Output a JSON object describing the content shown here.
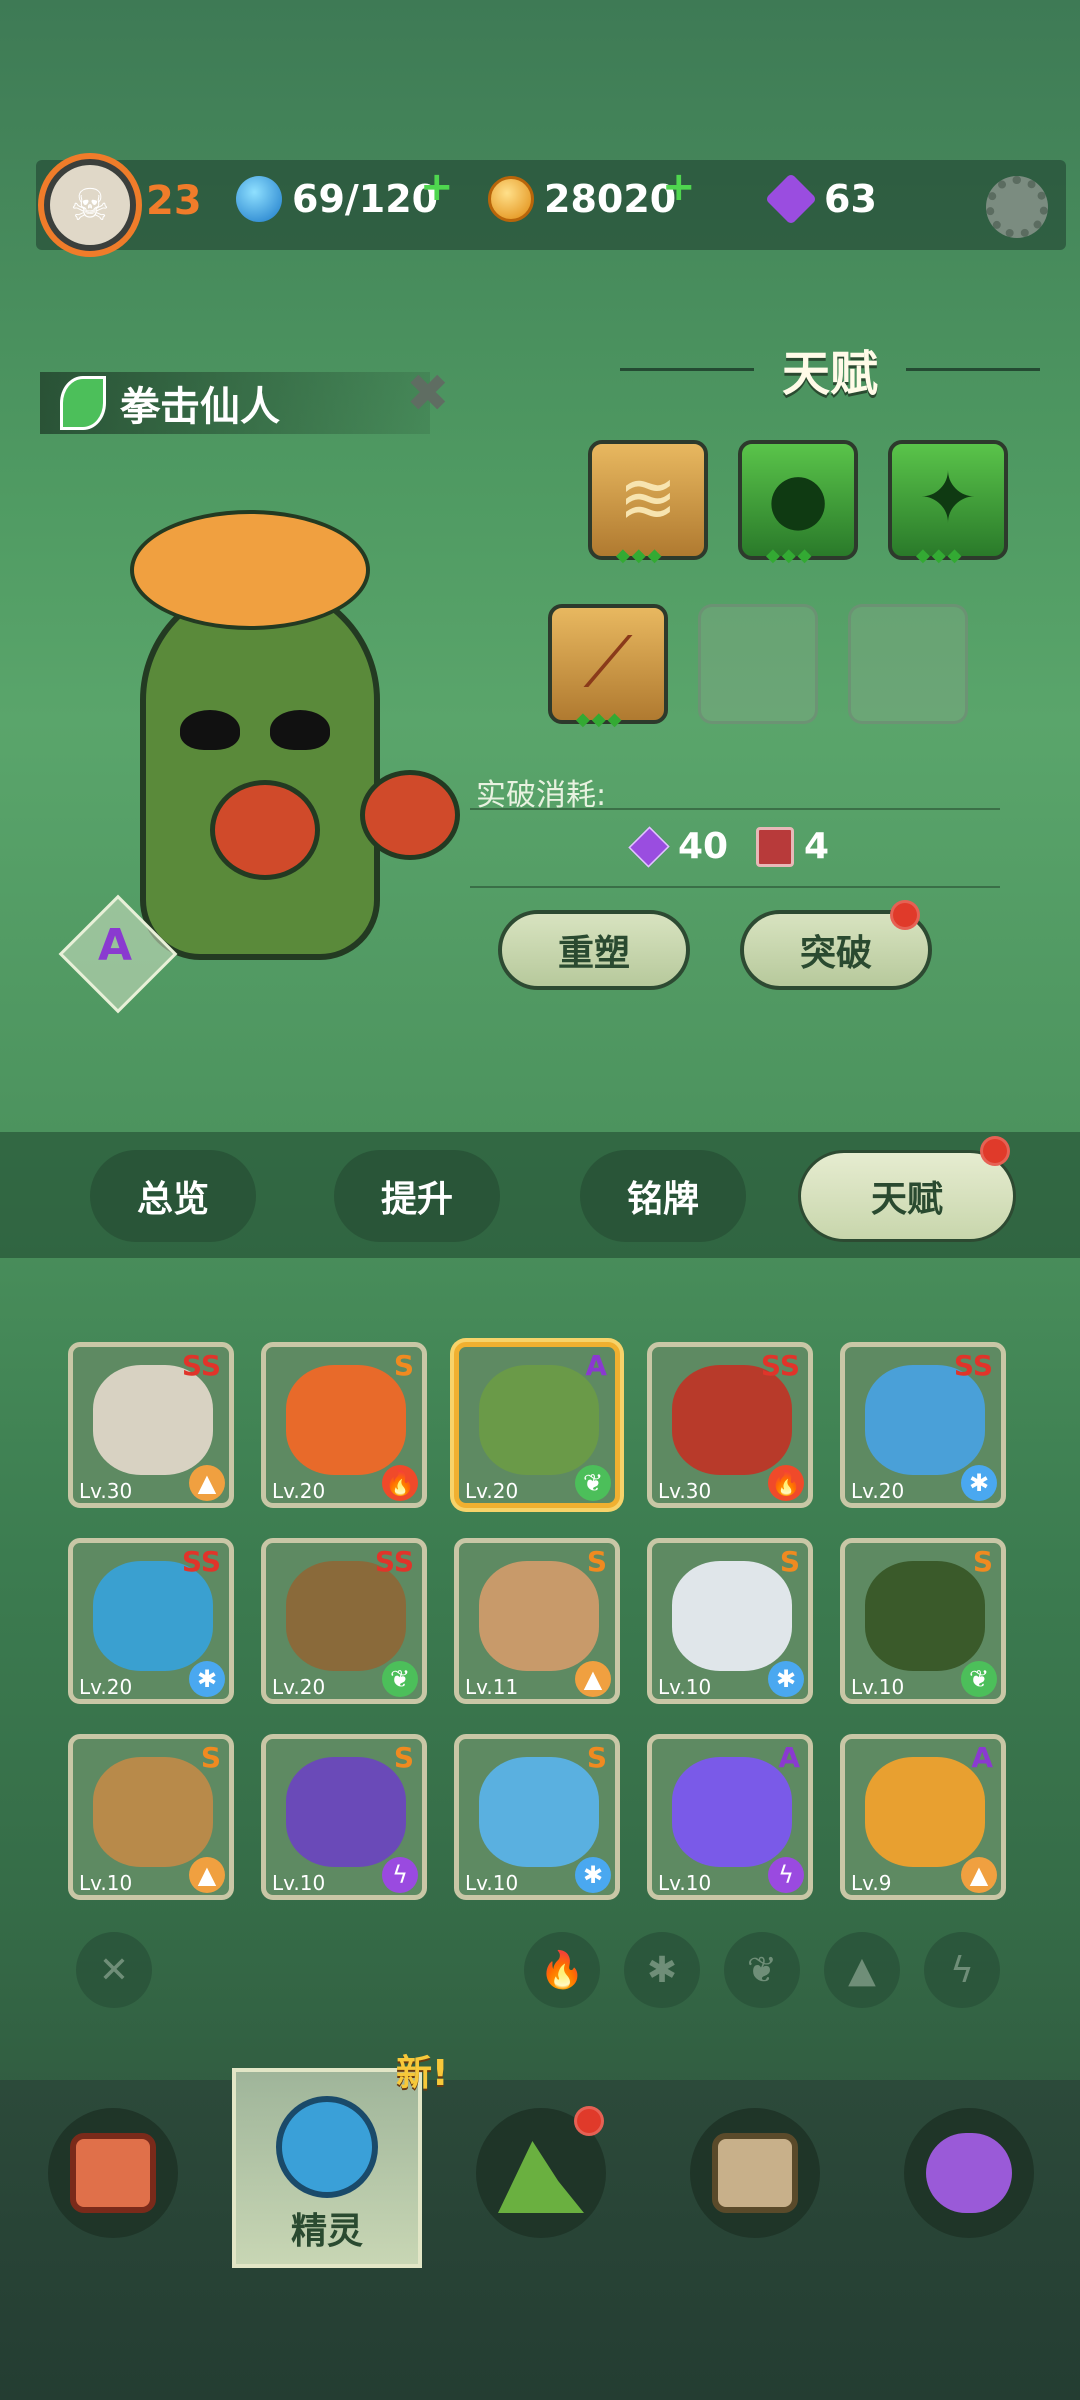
{
  "player": {
    "level": "23"
  },
  "resources": {
    "water": "69/120",
    "coins": "28020",
    "gems": "63"
  },
  "pet": {
    "name": "拳击仙人",
    "rank": "A"
  },
  "talent": {
    "title": "天赋",
    "cost_label": "实破消耗:",
    "cost_gems": "40",
    "cost_books": "4",
    "reroll_label": "重塑",
    "breakthrough_label": "突破"
  },
  "tabs": [
    {
      "label": "总览"
    },
    {
      "label": "提升"
    },
    {
      "label": "铭牌"
    },
    {
      "label": "天赋"
    }
  ],
  "cards": [
    {
      "grade": "SS",
      "lv": "Lv.30",
      "elem": "earth",
      "color": "#d8d2c2"
    },
    {
      "grade": "S",
      "lv": "Lv.20",
      "elem": "fire",
      "color": "#e86a2a"
    },
    {
      "grade": "A",
      "lv": "Lv.20",
      "elem": "grass",
      "color": "#6a9a48"
    },
    {
      "grade": "SS",
      "lv": "Lv.30",
      "elem": "fire",
      "color": "#b83a2a"
    },
    {
      "grade": "SS",
      "lv": "Lv.20",
      "elem": "ice",
      "color": "#4aa0d8"
    },
    {
      "grade": "SS",
      "lv": "Lv.20",
      "elem": "ice",
      "color": "#3aa0d0"
    },
    {
      "grade": "SS",
      "lv": "Lv.20",
      "elem": "grass",
      "color": "#8a6a3a"
    },
    {
      "grade": "S",
      "lv": "Lv.11",
      "elem": "earth",
      "color": "#c89a6a"
    },
    {
      "grade": "S",
      "lv": "Lv.10",
      "elem": "ice",
      "color": "#e0e6ea"
    },
    {
      "grade": "S",
      "lv": "Lv.10",
      "elem": "grass",
      "color": "#3a5a2a"
    },
    {
      "grade": "S",
      "lv": "Lv.10",
      "elem": "earth",
      "color": "#b88a4a"
    },
    {
      "grade": "S",
      "lv": "Lv.10",
      "elem": "electric",
      "color": "#6a4ab8"
    },
    {
      "grade": "S",
      "lv": "Lv.10",
      "elem": "ice",
      "color": "#5ab0e0"
    },
    {
      "grade": "A",
      "lv": "Lv.10",
      "elem": "electric",
      "color": "#7a5ae8"
    },
    {
      "grade": "A",
      "lv": "Lv.9",
      "elem": "earth",
      "color": "#e8a030"
    }
  ],
  "bottom_nav": {
    "active_label": "精灵",
    "new_tag": "新!"
  },
  "colors": {
    "accent_orange": "#f07c2a",
    "ss_red": "#e0342a",
    "s_orange": "#f08a20",
    "a_purple": "#8a3ad0"
  }
}
